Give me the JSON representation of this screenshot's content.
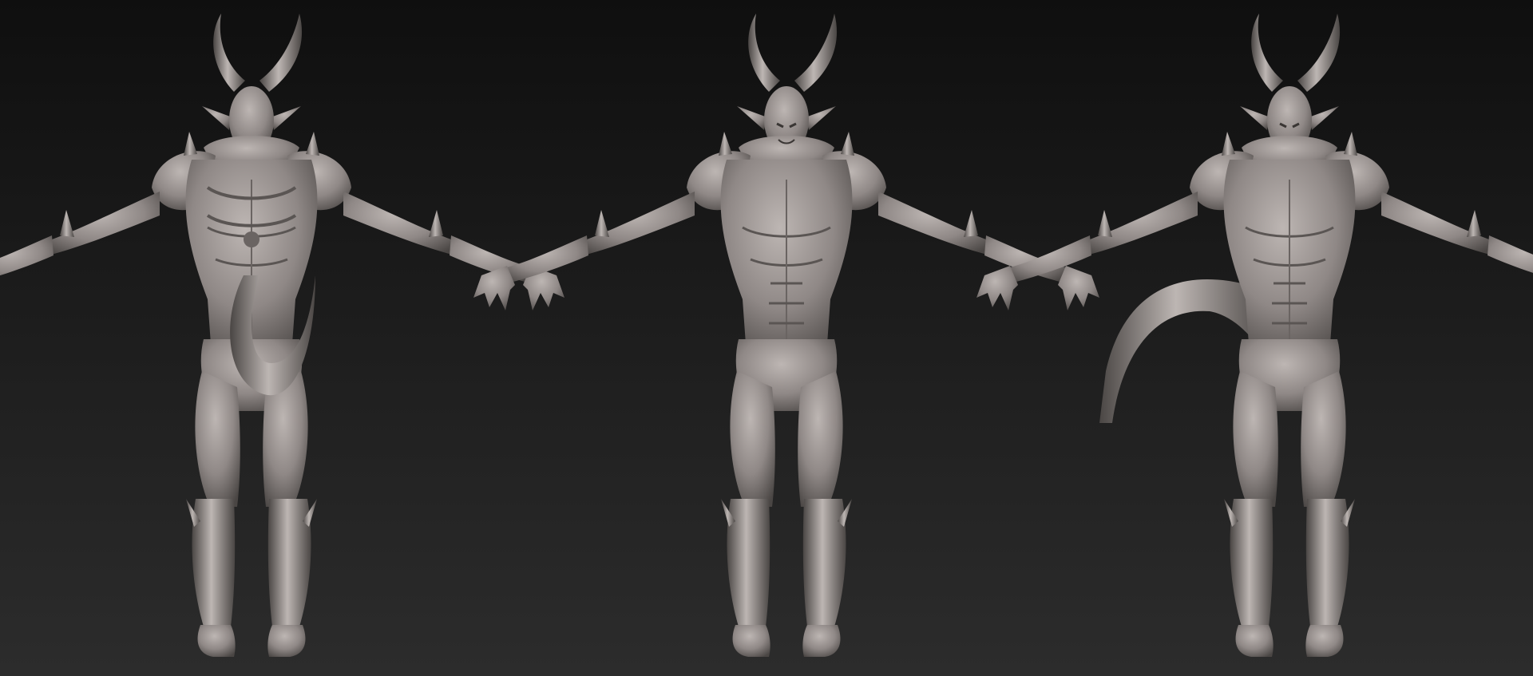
{
  "scene": {
    "background_top": "#0f0f0f",
    "background_bottom": "#2c2c2c",
    "clay_light": "#bdb6b3",
    "clay_mid": "#8f8886",
    "clay_dark": "#4a4644",
    "views": [
      {
        "id": "back",
        "orientation": "back",
        "tail": "center"
      },
      {
        "id": "front",
        "orientation": "front",
        "tail": "none"
      },
      {
        "id": "three-quarter",
        "orientation": "three-quarter",
        "tail": "left"
      }
    ]
  }
}
